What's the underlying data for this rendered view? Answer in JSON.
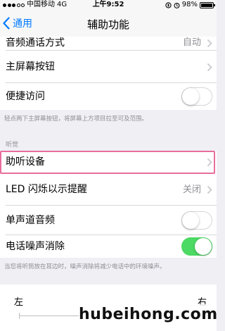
{
  "status": {
    "carrier": "中国移动",
    "network": "4G",
    "time": "上午9:52",
    "battery": "98%"
  },
  "nav": {
    "back_label": "通用",
    "title": "辅助功能"
  },
  "rows": {
    "audio_call": {
      "label": "音频通话方式",
      "value": "自动"
    },
    "home_button": {
      "label": "主屏幕按钮"
    },
    "reachability": {
      "label": "便捷访问",
      "on": false
    }
  },
  "reachability_footnote": "轻点两下主屏幕按钮，将屏幕上方项目拉至可及范围。",
  "hearing": {
    "header": "听觉",
    "hearing_devices": {
      "label": "助听设备"
    },
    "led_flash": {
      "label": "LED 闪烁以示提醒",
      "value": "关闭"
    },
    "mono_audio": {
      "label": "单声道音频",
      "on": false
    },
    "noise_cancel": {
      "label": "电话噪声消除",
      "on": true
    }
  },
  "noise_footnote": "当您将听筒放在耳边时，噪声消除将减少电话中的环境噪声。",
  "balance": {
    "left": "左",
    "right": "右"
  },
  "watermark": "hubeihong.com"
}
